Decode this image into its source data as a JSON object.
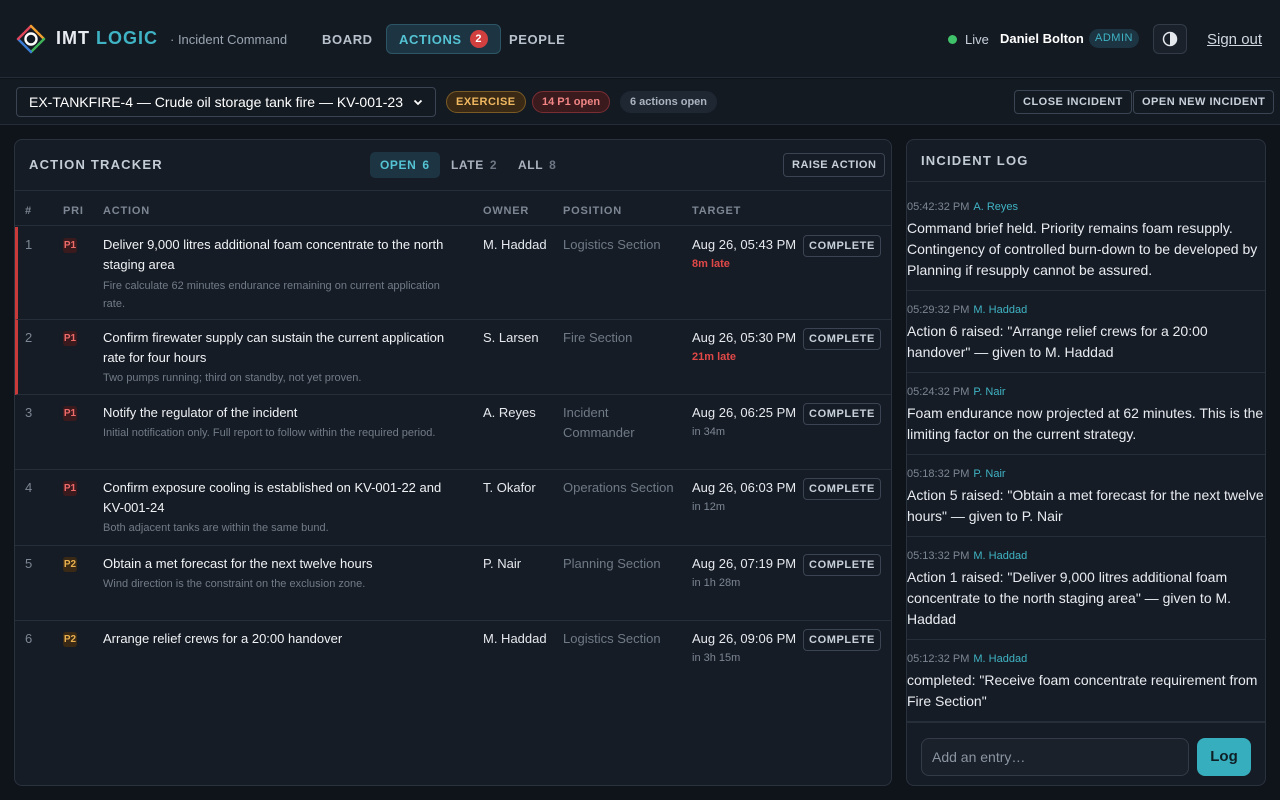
{
  "header": {
    "brand_part1": "IMT",
    "brand_part2": "LOGIC",
    "subtitle": "· Incident Command",
    "nav": {
      "board": "BOARD",
      "actions": "ACTIONS",
      "actions_badge": "2",
      "people": "PEOPLE"
    },
    "live_label": "Live",
    "user_name": "Daniel Bolton",
    "role": "ADMIN",
    "signout": "Sign out"
  },
  "subbar": {
    "incident": "EX-TANKFIRE-4 — Crude oil storage tank fire — KV-001-23",
    "exercise": "EXERCISE",
    "p1_open": "14 P1 open",
    "actions_open": "6 actions open",
    "close_incident": "CLOSE INCIDENT",
    "open_new_incident": "OPEN NEW INCIDENT"
  },
  "tracker": {
    "title": "ACTION TRACKER",
    "tabs": [
      {
        "label": "OPEN",
        "count": "6"
      },
      {
        "label": "LATE",
        "count": "2"
      },
      {
        "label": "ALL",
        "count": "8"
      }
    ],
    "raise_action": "RAISE ACTION",
    "columns": {
      "num": "#",
      "pri": "PRI",
      "action": "ACTION",
      "owner": "OWNER",
      "position": "POSITION",
      "target": "TARGET"
    },
    "complete_label": "COMPLETE",
    "rows": [
      {
        "num": "1",
        "pri": "P1",
        "title": "Deliver 9,000 litres additional foam concentrate to the north staging area",
        "note": "Fire calculate 62 minutes endurance remaining on current application rate.",
        "owner": "M. Haddad",
        "position": "Logistics Section",
        "target": "Aug 26, 05:43 PM",
        "due": "8m late"
      },
      {
        "num": "2",
        "pri": "P1",
        "title": "Confirm firewater supply can sustain the current application rate for four hours",
        "note": "Two pumps running; third on standby, not yet proven.",
        "owner": "S. Larsen",
        "position": "Fire Section",
        "target": "Aug 26, 05:30 PM",
        "due": "21m late"
      },
      {
        "num": "3",
        "pri": "P1",
        "title": "Notify the regulator of the incident",
        "note": "Initial notification only. Full report to follow within the required period.",
        "owner": "A. Reyes",
        "position": "Incident Commander",
        "target": "Aug 26, 06:25 PM",
        "due": "in 34m"
      },
      {
        "num": "4",
        "pri": "P1",
        "title": "Confirm exposure cooling is established on KV-001-22 and KV-001-24",
        "note": "Both adjacent tanks are within the same bund.",
        "owner": "T. Okafor",
        "position": "Operations Section",
        "target": "Aug 26, 06:03 PM",
        "due": "in 12m"
      },
      {
        "num": "5",
        "pri": "P2",
        "title": "Obtain a met forecast for the next twelve hours",
        "note": "Wind direction is the constraint on the exclusion zone.",
        "owner": "P. Nair",
        "position": "Planning Section",
        "target": "Aug 26, 07:19 PM",
        "due": "in 1h 28m"
      },
      {
        "num": "6",
        "pri": "P2",
        "title": "Arrange relief crews for a 20:00 handover",
        "note": "",
        "owner": "M. Haddad",
        "position": "Logistics Section",
        "target": "Aug 26, 09:06 PM",
        "due": "in 3h 15m"
      }
    ]
  },
  "log": {
    "title": "INCIDENT LOG",
    "entries": [
      {
        "time": "05:42:32 PM",
        "who": "A. Reyes",
        "text": "Command brief held. Priority remains foam resupply. Contingency of controlled burn-down to be developed by Planning if resupply cannot be assured."
      },
      {
        "time": "05:29:32 PM",
        "who": "M. Haddad",
        "text": "Action 6 raised: \"Arrange relief crews for a 20:00 handover\" — given to M. Haddad"
      },
      {
        "time": "05:24:32 PM",
        "who": "P. Nair",
        "text": "Foam endurance now projected at 62 minutes. This is the limiting factor on the current strategy."
      },
      {
        "time": "05:18:32 PM",
        "who": "P. Nair",
        "text": "Action 5 raised: \"Obtain a met forecast for the next twelve hours\" — given to P. Nair"
      },
      {
        "time": "05:13:32 PM",
        "who": "M. Haddad",
        "text": "Action 1 raised: \"Deliver 9,000 litres additional foam concentrate to the north staging area\" — given to M. Haddad"
      },
      {
        "time": "05:12:32 PM",
        "who": "M. Haddad",
        "text": "completed: \"Receive foam concentrate requirement from Fire Section\""
      }
    ],
    "input_placeholder": "Add an entry…",
    "log_button": "Log"
  },
  "colors": {
    "accent": "#3fb3c4",
    "late": "#e04848",
    "p1": "#ee6b6b",
    "p2": "#e8b04f",
    "live": "#3fc26a"
  },
  "icons": {
    "logo": "imt-logo-icon",
    "theme": "contrast-icon",
    "select": "chevron-down-icon"
  }
}
